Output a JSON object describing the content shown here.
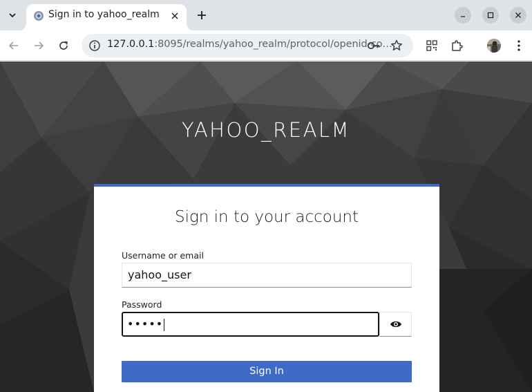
{
  "browser": {
    "tab": {
      "title": "Sign in to yahoo_realm",
      "favicon": "keycloak-favicon-icon"
    },
    "new_tab_icon": "plus-icon",
    "address_bar": {
      "host": "127.0.0.1",
      "rest": ":8095/realms/yahoo_realm/protocol/openid-co…"
    },
    "icons": [
      "chevron-down-icon",
      "close-icon",
      "minimize-icon",
      "maximize-icon",
      "back-arrow-icon",
      "forward-arrow-icon",
      "reload-icon",
      "info-icon",
      "key-icon",
      "star-icon",
      "qr-code-icon",
      "extensions-icon",
      "profile-avatar",
      "kebab-menu-icon"
    ]
  },
  "page": {
    "realm_title": "YAHOO_REALM",
    "form": {
      "heading": "Sign in to your account",
      "username_label": "Username or email",
      "username_value": "yahoo_user",
      "password_label": "Password",
      "password_masked": "•••••",
      "submit_label": "Sign In"
    }
  },
  "colors": {
    "accent": "#3e6bc6",
    "page_bg": "#3a3a3a",
    "chrome_bg": "#dfe3e8"
  }
}
